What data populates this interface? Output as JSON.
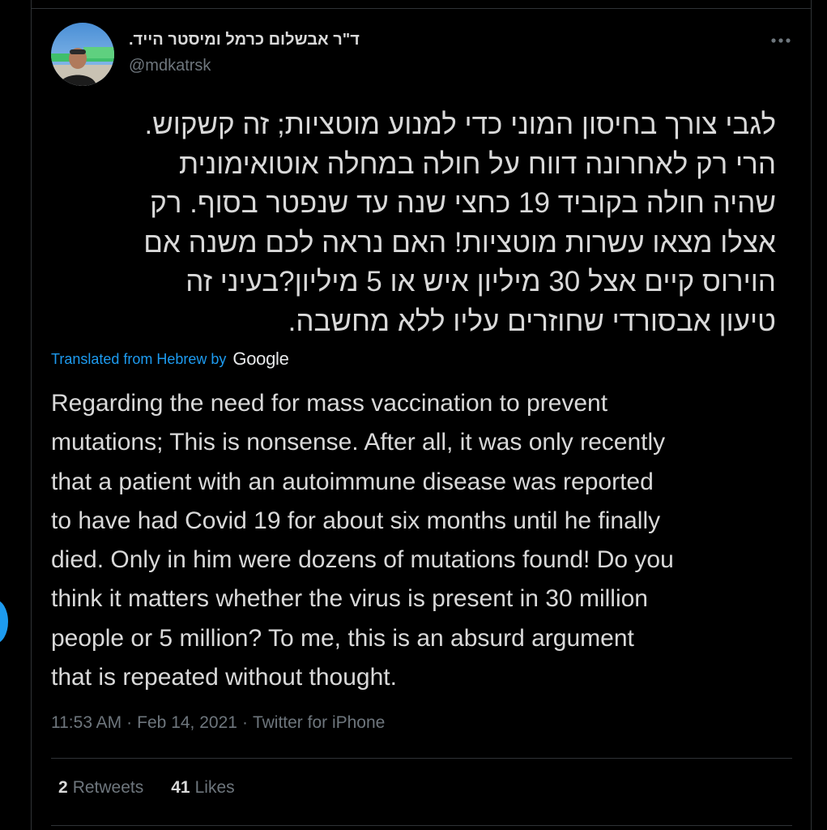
{
  "tweet": {
    "author": {
      "display_name": "ד\"ר אבשלום כרמל ומיסטר הייד.",
      "handle": "@mdkatrsk"
    },
    "original_lines": [
      "לגבי צורך בחיסון המוני כדי למנוע מוטציות; זה קשקוש.",
      "הרי רק לאחרונה דווח על חולה במחלה אוטואימונית",
      "שהיה חולה בקוביד 19 כחצי שנה עד שנפטר בסוף. רק",
      "אצלו מצאו עשרות מוטציות! האם נראה לכם משנה אם",
      "הוירוס קיים אצל 30 מיליון איש או 5 מיליון?בעיני זה",
      "טיעון אבסורדי שחוזרים עליו ללא מחשבה."
    ],
    "translation_label": "Translated from Hebrew by",
    "translation_provider": "Google",
    "translated_lines": [
      "Regarding the need for mass vaccination to prevent",
      "mutations; This is nonsense. After all, it was only recently",
      "that a patient with an autoimmune disease was reported",
      "to have had Covid 19 for about six months until he finally",
      "died. Only in him were dozens of mutations found! Do you",
      "think it matters whether the virus is present in 30 million",
      "people or 5 million? To me, this is an absurd argument",
      "that is repeated without thought."
    ],
    "time": "11:53 AM",
    "date": "Feb 14, 2021",
    "source": "Twitter for iPhone",
    "separator": "·",
    "retweets": {
      "count": "2",
      "label": "Retweets"
    },
    "likes": {
      "count": "41",
      "label": "Likes"
    }
  },
  "icons": {
    "more": "more-horizontal-icon",
    "avatar": "profile-photo"
  },
  "colors": {
    "background": "#000000",
    "text": "#d9d9d9",
    "secondary_text": "#6e767d",
    "accent": "#1d9bf0",
    "divider": "#2f3336"
  }
}
